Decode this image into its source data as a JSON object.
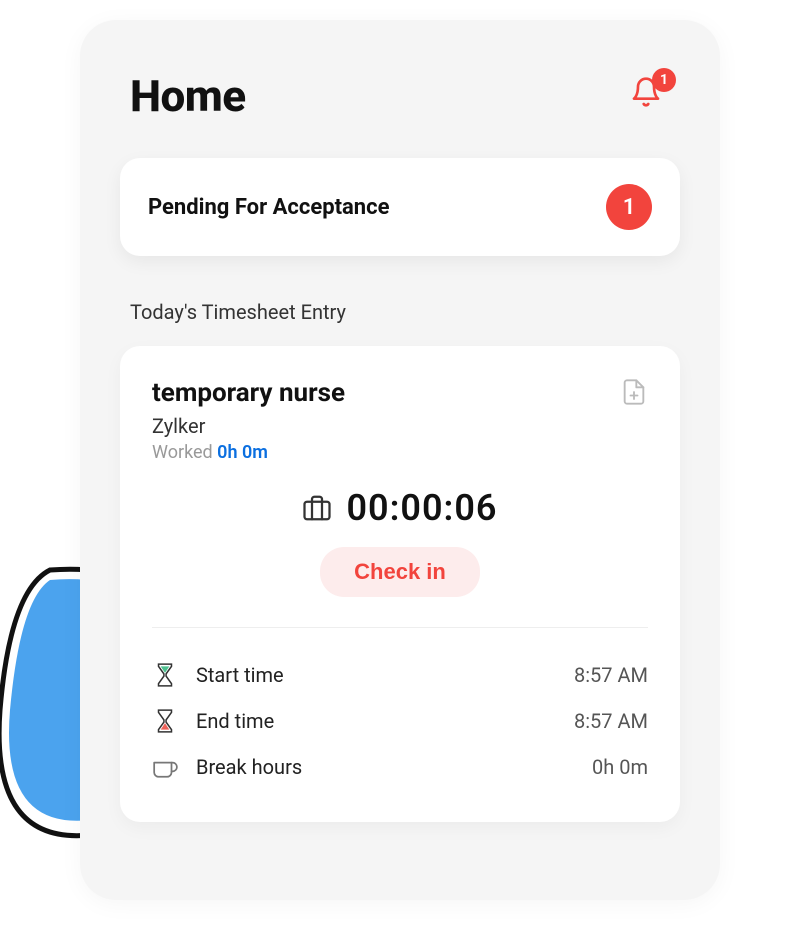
{
  "header": {
    "title": "Home",
    "notification_count": "1"
  },
  "pending": {
    "title": "Pending For Acceptance",
    "count": "1"
  },
  "timesheet": {
    "section_label": "Today's Timesheet Entry",
    "job_title": "temporary nurse",
    "company": "Zylker",
    "worked_label": "Worked ",
    "worked_value": "0h 0m",
    "timer": "00:00:06",
    "checkin_label": "Check in",
    "rows": {
      "start": {
        "label": "Start time",
        "value": "8:57 AM"
      },
      "end": {
        "label": "End time",
        "value": "8:57 AM"
      },
      "break": {
        "label": "Break hours",
        "value": "0h 0m"
      }
    }
  },
  "colors": {
    "accent": "#f2443d",
    "link": "#0b6fe0"
  }
}
